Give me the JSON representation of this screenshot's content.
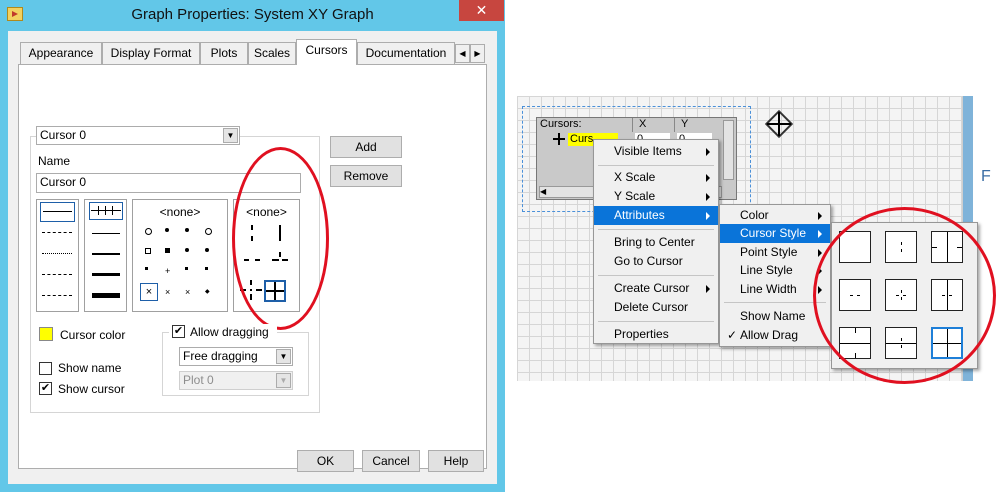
{
  "dialog": {
    "title": "Graph Properties: System XY Graph",
    "close_glyph": "✕",
    "tabs": [
      "Appearance",
      "Display Format",
      "Plots",
      "Scales",
      "Cursors",
      "Documentation"
    ],
    "active_tab": "Cursors",
    "cursor_select": "Cursor 0",
    "name_label": "Name",
    "name_value": "Cursor 0",
    "add_label": "Add",
    "remove_label": "Remove",
    "point_style_none": "<none>",
    "cursor_style_none": "<none>",
    "cursor_color_label": "Cursor color",
    "cursor_color": "#ffff00",
    "show_name_label": "Show name",
    "show_cursor_label": "Show cursor",
    "allow_dragging_label": "Allow dragging",
    "drag_mode": "Free dragging",
    "plot_select": "Plot 0",
    "ok_label": "OK",
    "cancel_label": "Cancel",
    "help_label": "Help",
    "checkbox_glyph": "✔"
  },
  "cursor_legend": {
    "col_cursors": "Cursors:",
    "col_x": "X",
    "col_y": "Y",
    "row_name": "Curs",
    "row_x": "0",
    "row_y": "0"
  },
  "context_menu": {
    "items": [
      "Visible Items",
      "X Scale",
      "Y Scale",
      "Attributes",
      "Bring to Center",
      "Go to Cursor",
      "Create Cursor",
      "Delete Cursor",
      "Properties"
    ],
    "highlighted": "Attributes"
  },
  "attributes_menu": {
    "items": [
      "Color",
      "Cursor Style",
      "Point Style",
      "Line Style",
      "Line Width",
      "Show Name",
      "Allow Drag"
    ],
    "highlighted": "Cursor Style",
    "checked": "Allow Drag",
    "check_glyph": "✓"
  },
  "right_panel_partial_text": "F",
  "colors": {
    "title_bar": "#62c7e8",
    "close_button": "#c7463f",
    "menu_highlight": "#0a74d9",
    "selected_style": "#1e7fd8",
    "annotation_ring": "#e01020",
    "cursor_color_swatch": "#ffff00"
  }
}
